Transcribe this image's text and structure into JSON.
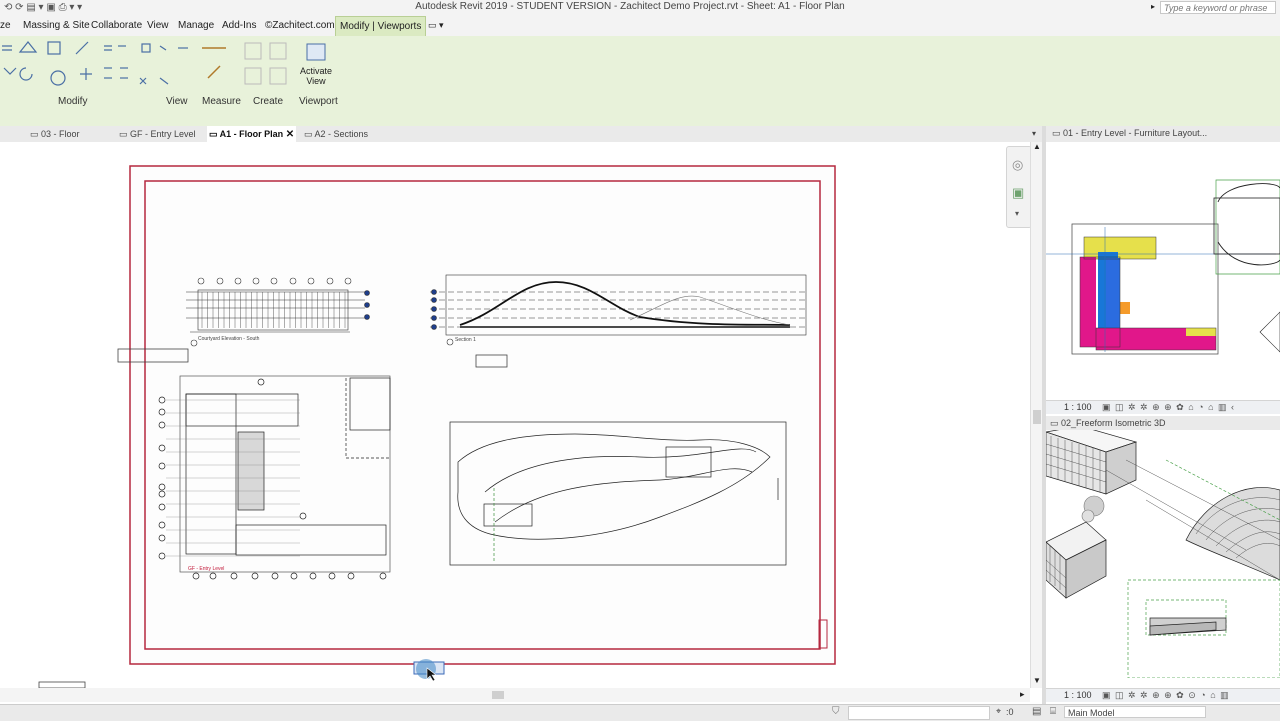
{
  "window": {
    "title": "Autodesk Revit 2019 - STUDENT VERSION - Zachitect Demo Project.rvt - Sheet: A1 - Floor Plan"
  },
  "search": {
    "placeholder": "Type a keyword or phrase"
  },
  "menu": [
    "ze",
    "Massing & Site",
    "Collaborate",
    "View",
    "Manage",
    "Add-Ins",
    "©Zachitect.com",
    "Modify | Viewports"
  ],
  "ribbon": {
    "panels": [
      "Modify",
      "View",
      "Measure",
      "Create",
      "Viewport"
    ],
    "activate_view": "Activate\nView"
  },
  "tabs": [
    {
      "label": "03 - Floor",
      "active": false
    },
    {
      "label": "GF - Entry Level",
      "active": false
    },
    {
      "label": "A1 - Floor Plan",
      "active": true
    },
    {
      "label": "A2 - Sections",
      "active": false
    }
  ],
  "right_panel": {
    "view1_title": "01 - Entry Level - Furniture Layout...",
    "view1_scale": "1 : 100",
    "view2_title": "02_Freeform Isometric 3D",
    "view2_scale": "1 : 100"
  },
  "sheet": {
    "elevation_label": "Courtyard Elevation - South",
    "section_label": "Section 1",
    "plan_label": "GF - Entry Level"
  },
  "status": {
    "model": "Main Model",
    "sel_count": ":0"
  },
  "colors": {
    "sheet_border": "#b5283f",
    "ribbon_bg": "#e8f2da",
    "tab_active": "#ffffff",
    "magenta": "#e1178a",
    "blue": "#1877d8",
    "yellow": "#e6e04b"
  }
}
